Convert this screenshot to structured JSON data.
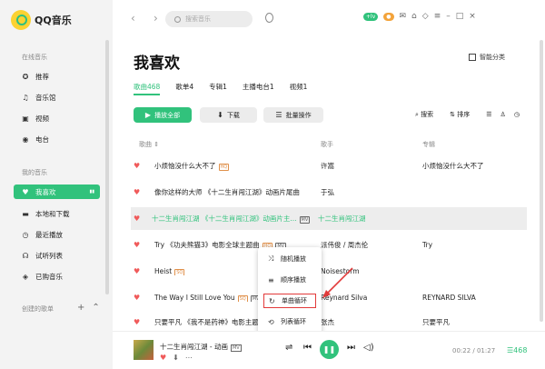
{
  "app": {
    "name": "QQ音乐"
  },
  "sidebar": {
    "online_label": "在线音乐",
    "online": [
      {
        "label": "推荐",
        "icon": "star"
      },
      {
        "label": "音乐馆",
        "icon": "music-note"
      },
      {
        "label": "视频",
        "icon": "video"
      },
      {
        "label": "电台",
        "icon": "radio"
      }
    ],
    "mine_label": "我的音乐",
    "mine": [
      {
        "label": "我喜欢",
        "icon": "heart",
        "active": true
      },
      {
        "label": "本地和下载",
        "icon": "download"
      },
      {
        "label": "最近播放",
        "icon": "clock"
      },
      {
        "label": "试听列表",
        "icon": "headphones"
      },
      {
        "label": "已购音乐",
        "icon": "cart"
      }
    ],
    "created_label": "创建的歌单"
  },
  "topbar": {
    "search_placeholder": "搜索音乐"
  },
  "main": {
    "title": "我喜欢",
    "smart_label": "智能分类",
    "tabs": [
      "歌曲468",
      "歌单4",
      "专辑1",
      "主播电台1",
      "视频1"
    ],
    "buttons": {
      "play_all": "播放全部",
      "download": "下载",
      "batch": "批量操作"
    },
    "tools": {
      "search": "搜索",
      "sort": "排序"
    },
    "columns": {
      "song": "歌曲",
      "artist": "歌手",
      "album": "专辑"
    },
    "rows": [
      {
        "name": "小烦恼没什么大不了",
        "badge": "HQ",
        "artist": "许嵩",
        "album": "小烦恼没什么大不了"
      },
      {
        "name": "像你这样的大师 《十二生肖闯江湖》动画片尾曲",
        "artist": "于弘",
        "album": ""
      },
      {
        "name": "十二生肖闯江湖 《十二生肖闯江湖》动画片主...",
        "mv": "MV",
        "artist": "十二生肖闯江湖",
        "album": "",
        "highlight": true
      },
      {
        "name": "Try 《功夫熊猫3》电影全球主题曲",
        "badge": "HQ",
        "mv": "MV",
        "artist": "派伟俊 / 周杰伦",
        "album": "Try"
      },
      {
        "name": "Heist",
        "badge": "SQ",
        "artist": "Noisestorm",
        "album": ""
      },
      {
        "name": "The Way I Still Love You",
        "badge": "SQ",
        "mv": "MV",
        "artist": "Reynard Silva",
        "album": "REYNARD SILVA"
      },
      {
        "name": "只要平凡 《我不是药神》电影主题曲",
        "artist": "张杰",
        "album": "只要平凡"
      }
    ]
  },
  "popup": {
    "items": [
      {
        "label": "随机播放",
        "icon": "shuffle"
      },
      {
        "label": "顺序播放",
        "icon": "order"
      },
      {
        "label": "单曲循环",
        "icon": "repeat-one",
        "selected": true
      },
      {
        "label": "列表循环",
        "icon": "repeat"
      }
    ]
  },
  "player": {
    "title": "十二生肖闯江湖 - 动画",
    "time": "00:22 / 01:27",
    "count": "468"
  }
}
